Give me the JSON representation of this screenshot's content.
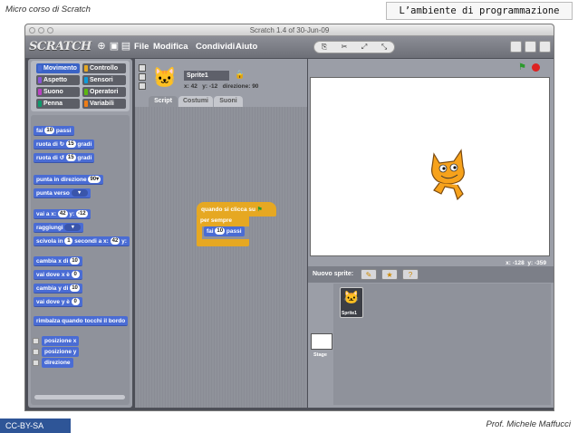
{
  "slide": {
    "top_left": "Micro corso di Scratch",
    "title": "L’ambiente di programmazione",
    "footer_left": "CC-BY-SA",
    "footer_right": "Prof. Michele Maffucci"
  },
  "window": {
    "title": "Scratch 1.4 of 30-Jun-09"
  },
  "menubar": {
    "logo": "SCRATCH",
    "menus": [
      "File",
      "Modifica",
      "Condividi",
      "Aiuto"
    ]
  },
  "categories": [
    {
      "label": "Movimento",
      "color": "#4a6cd4"
    },
    {
      "label": "Controllo",
      "color": "#e6a822"
    },
    {
      "label": "Aspetto",
      "color": "#8a55d7"
    },
    {
      "label": "Sensori",
      "color": "#0e9bd8"
    },
    {
      "label": "Suono",
      "color": "#bb42c3"
    },
    {
      "label": "Operatori",
      "color": "#5cb712"
    },
    {
      "label": "Penna",
      "color": "#0e9a6c"
    },
    {
      "label": "Variabili",
      "color": "#ee7d16"
    }
  ],
  "blocks": {
    "move": {
      "pre": "fai",
      "val": "10",
      "post": "passi"
    },
    "turn_right": {
      "pre": "ruota di",
      "val": "15",
      "post": "gradi"
    },
    "turn_left": {
      "pre": "ruota di",
      "val": "15",
      "post": "gradi"
    },
    "point_dir": {
      "pre": "punta in direzione",
      "val": "90▾"
    },
    "point_to": {
      "pre": "punta verso",
      "val": "▾"
    },
    "goto_xy": {
      "pre": "vai a x:",
      "x": "42",
      "mid": "y:",
      "y": "-12"
    },
    "goto": {
      "pre": "raggiungi",
      "val": "▾"
    },
    "glide": {
      "pre": "scivola in",
      "s": "1",
      "mid": "secondi a x:",
      "x": "42",
      "end": "y:"
    },
    "change_x": {
      "pre": "cambia x di",
      "val": "10"
    },
    "set_x": {
      "pre": "vai dove x è",
      "val": "0"
    },
    "change_y": {
      "pre": "cambia y di",
      "val": "10"
    },
    "set_y": {
      "pre": "vai dove y è",
      "val": "0"
    },
    "bounce": "rimbalza quando tocchi il bordo",
    "rep_x": "posizione x",
    "rep_y": "posizione y",
    "rep_dir": "direzione"
  },
  "sprite_info": {
    "name": "Sprite1",
    "x_label": "x:",
    "x": "42",
    "y_label": "y:",
    "y": "-12",
    "dir_label": "direzione:",
    "dir": "90"
  },
  "tabs": [
    "Script",
    "Costumi",
    "Suoni"
  ],
  "script": {
    "hat": "quando si clicca su",
    "forever": "per sempre",
    "move_pre": "fai",
    "move_val": "10",
    "move_post": "passi"
  },
  "stage": {
    "mouse_x_label": "x:",
    "mouse_x": "-128",
    "mouse_y_label": "y:",
    "mouse_y": "-359",
    "new_sprite": "Nuovo sprite:",
    "stage_label": "Stage",
    "sprite_thumb_label": "Sprite1"
  }
}
